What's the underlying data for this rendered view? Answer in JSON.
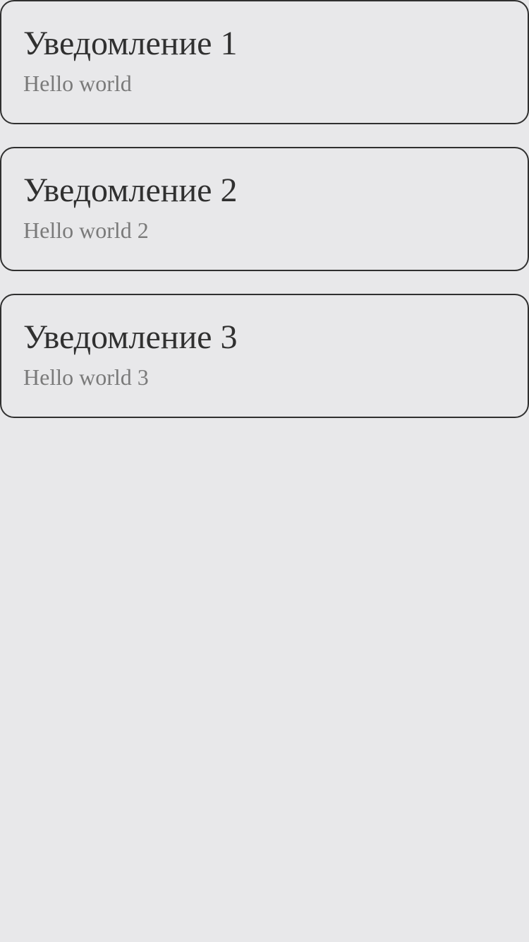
{
  "notifications": [
    {
      "title": "Уведомление 1",
      "text": "Hello world"
    },
    {
      "title": "Уведомление 2",
      "text": "Hello world 2"
    },
    {
      "title": "Уведомление 3",
      "text": "Hello world 3"
    }
  ],
  "colors": {
    "background": "#e8e8ea",
    "border": "#303030",
    "title": "#303030",
    "text": "#7a7a7a"
  }
}
